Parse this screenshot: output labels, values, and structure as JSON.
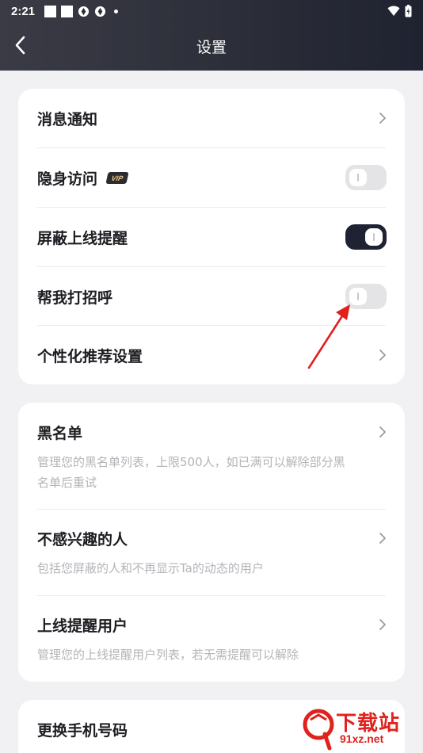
{
  "status_bar": {
    "time": "2:21"
  },
  "header": {
    "title": "设置"
  },
  "card1": {
    "items": [
      {
        "label": "消息通知"
      },
      {
        "label": "隐身访问",
        "badge": "VIP",
        "toggle": "off"
      },
      {
        "label": "屏蔽上线提醒",
        "toggle": "on"
      },
      {
        "label": "帮我打招呼",
        "toggle": "off"
      },
      {
        "label": "个性化推荐设置"
      }
    ]
  },
  "card2": {
    "items": [
      {
        "label": "黑名单",
        "desc_line1": "管理您的黑名单列表，上限500人，如已满可以解除部分黑",
        "desc_line2": "名单后重试"
      },
      {
        "label": "不感兴趣的人",
        "desc": "包括您屏蔽的人和不再显示Ta的动态的用户"
      },
      {
        "label": "上线提醒用户",
        "desc": "管理您的上线提醒用户列表，若无需提醒可以解除"
      }
    ]
  },
  "card3": {
    "items": [
      {
        "label": "更换手机号码"
      }
    ]
  },
  "watermark": {
    "text_main": "下载站",
    "text_url": "91xz.net"
  },
  "colors": {
    "header_dark": "#1f2230",
    "toggle_on": "#1e2233",
    "toggle_off": "#e4e4e7",
    "annotation_arrow": "#e0211c"
  }
}
